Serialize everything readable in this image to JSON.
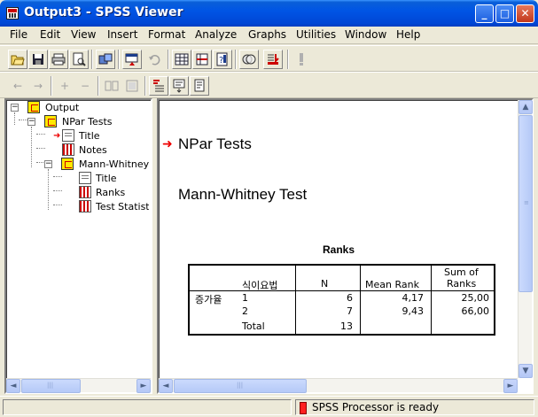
{
  "window": {
    "title": "Output3 - SPSS Viewer",
    "controls": {
      "minimize": "_",
      "maximize": "□",
      "close": "✕"
    }
  },
  "menu": [
    "File",
    "Edit",
    "View",
    "Insert",
    "Format",
    "Analyze",
    "Graphs",
    "Utilities",
    "Window",
    "Help"
  ],
  "toolbar1": {
    "buttons": [
      "open-icon",
      "save-icon",
      "print-icon",
      "print-preview-icon",
      "export-icon",
      "dialog-recall-icon",
      "undo-icon",
      "goto-data-icon",
      "goto-case-icon",
      "variables-icon",
      "use-sets-icon",
      "select-last-output-icon",
      "designate-window-icon",
      "run-script-icon"
    ]
  },
  "toolbar2": {
    "buttons": [
      "promote-icon",
      "demote-icon",
      "expand-icon",
      "collapse-icon",
      "show-icon",
      "hide-icon",
      "insert-heading-icon",
      "insert-title-icon",
      "insert-text-icon"
    ],
    "glyphs": {
      "left": "←",
      "right": "→",
      "plus": "+",
      "minus": "−"
    }
  },
  "outline": {
    "items": [
      {
        "label": "Output",
        "icon": "book-icon"
      },
      {
        "label": "NPar Tests",
        "icon": "book-icon"
      },
      {
        "label": "Title",
        "icon": "page-icon"
      },
      {
        "label": "Notes",
        "icon": "table-icon"
      },
      {
        "label": "Mann-Whitney Test",
        "icon": "book-icon"
      },
      {
        "label": "Title",
        "icon": "page-icon"
      },
      {
        "label": "Ranks",
        "icon": "table-icon"
      },
      {
        "label": "Test Statistics",
        "icon": "table-icon"
      }
    ],
    "expander_symbol": "−",
    "arrow": "➜"
  },
  "content": {
    "section_heading": "NPar Tests",
    "test_heading": "Mann-Whitney Test",
    "arrow": "➜",
    "ranks_table": {
      "title": "Ranks",
      "header": {
        "group": "식이요법",
        "n": "N",
        "mean_rank": "Mean Rank",
        "sum_of_ranks_line1": "Sum of",
        "sum_of_ranks_line2": "Ranks"
      },
      "row_label": "증가율",
      "rows": [
        {
          "group": "1",
          "n": "6",
          "mean_rank": "4,17",
          "sum_of_ranks": "25,00"
        },
        {
          "group": "2",
          "n": "7",
          "mean_rank": "9,43",
          "sum_of_ranks": "66,00"
        },
        {
          "group": "Total",
          "n": "13",
          "mean_rank": "",
          "sum_of_ranks": ""
        }
      ]
    }
  },
  "scrollbars": {
    "left": "◄",
    "right": "►",
    "up": "▲",
    "down": "▼",
    "grip": "|||"
  },
  "status": {
    "text": "SPSS Processor  is ready"
  },
  "colors": {
    "titlebar": "#0055e5",
    "accent_arrow": "#ee0000",
    "folder": "#ffe800"
  }
}
